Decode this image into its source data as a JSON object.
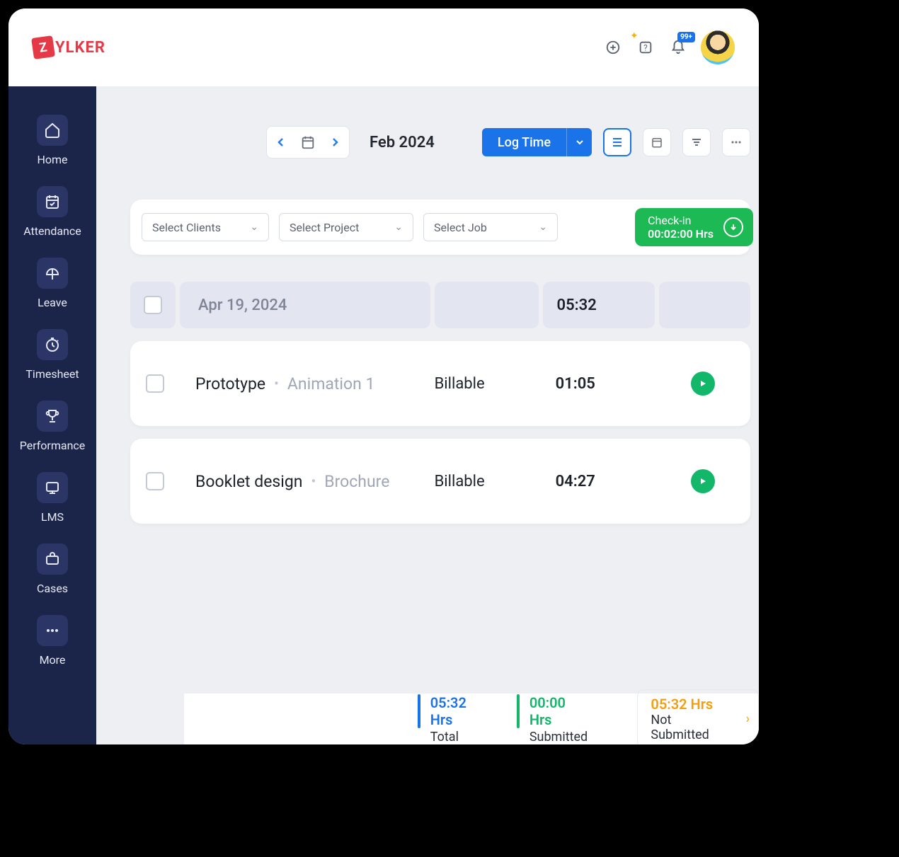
{
  "brand": {
    "badge": "Z",
    "name": "YLKER"
  },
  "topbar": {
    "notification_badge": "99+"
  },
  "sidebar": {
    "items": [
      {
        "label": "Home"
      },
      {
        "label": "Attendance"
      },
      {
        "label": "Leave"
      },
      {
        "label": "Timesheet"
      },
      {
        "label": "Performance"
      },
      {
        "label": "LMS"
      },
      {
        "label": "Cases"
      },
      {
        "label": "More"
      }
    ]
  },
  "toolbar": {
    "month_label": "Feb 2024",
    "log_time_label": "Log Time"
  },
  "filters": {
    "clients": "Select Clients",
    "project": "Select Project",
    "job": "Select Job"
  },
  "checkin": {
    "title": "Check-in",
    "time": "00:02:00 Hrs"
  },
  "list": {
    "date": "Apr 19, 2024",
    "date_total": "05:32",
    "rows": [
      {
        "project": "Prototype",
        "task": "Animation 1",
        "billable": "Billable",
        "time": "01:05"
      },
      {
        "project": "Booklet design",
        "task": "Brochure",
        "billable": "Billable",
        "time": "04:27"
      }
    ]
  },
  "footer": {
    "total": {
      "value": "05:32 Hrs",
      "label": "Total",
      "color": "#1a73e8"
    },
    "submitted": {
      "value": "00:00 Hrs",
      "label": "Submitted",
      "color": "#12b76a"
    },
    "not_submitted": {
      "value": "05:32 Hrs",
      "label": "Not Submitted"
    }
  }
}
